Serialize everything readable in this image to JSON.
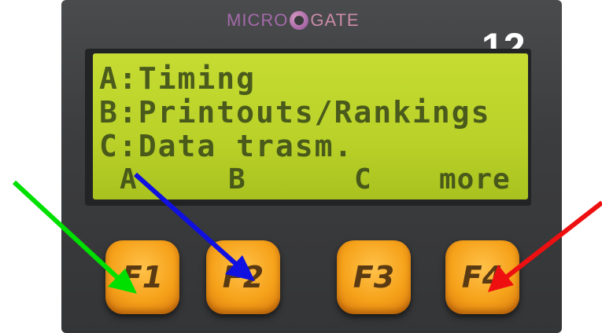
{
  "brand": {
    "logo_left": "MICRO",
    "logo_right": "GATE"
  },
  "badge": {
    "number": "12"
  },
  "lcd": {
    "lines": [
      "A:Timing",
      "B:Printouts/Rankings",
      "C:Data trasm."
    ],
    "softkeys": [
      "A",
      "B",
      "C",
      "more"
    ]
  },
  "buttons": [
    {
      "label": "F1"
    },
    {
      "label": "F2"
    },
    {
      "label": "F3"
    },
    {
      "label": "F4"
    }
  ],
  "arrows": [
    {
      "target": "F1",
      "color": "#00e000"
    },
    {
      "target": "F2",
      "color": "#1010e0"
    },
    {
      "target": "F4",
      "color": "#ee1010"
    }
  ]
}
